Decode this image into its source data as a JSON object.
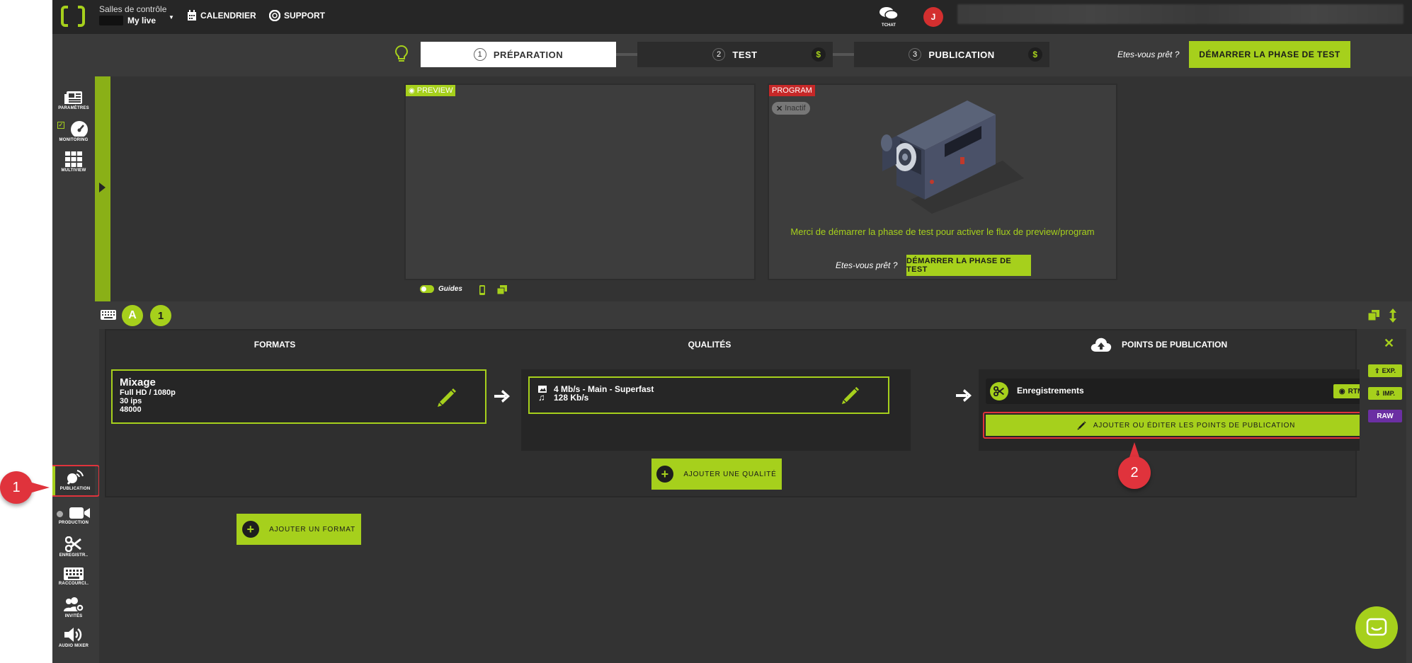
{
  "header": {
    "control_room_label": "Salles de contrôle",
    "live_name": "My live",
    "calendar_label": "CALENDRIER",
    "support_label": "SUPPORT",
    "chat_label": "TCHAT",
    "avatar_initial": "J"
  },
  "steps": [
    {
      "num": "1",
      "label": "PRÉPARATION"
    },
    {
      "num": "2",
      "label": "TEST",
      "badge": "$"
    },
    {
      "num": "3",
      "label": "PUBLICATION",
      "badge": "$"
    }
  ],
  "ready_prompt": "Etes-vous prêt ?",
  "start_test_label": "DÉMARRER LA PHASE DE TEST",
  "sidebar": {
    "top": [
      {
        "label": "PARAMÈTRES",
        "icon": "newspaper-icon"
      },
      {
        "label": "MONITORING",
        "icon": "gauge-icon"
      },
      {
        "label": "MULTIVIEW",
        "icon": "grid-icon"
      }
    ],
    "bottom": [
      {
        "label": "PUBLICATION",
        "icon": "broadcast-icon"
      },
      {
        "label": "PRODUCTION",
        "icon": "video-camera-icon"
      },
      {
        "label": "ENREGISTR..",
        "icon": "scissors-icon"
      },
      {
        "label": "RACCOURCI..",
        "icon": "keyboard-icon"
      },
      {
        "label": "INVITÉS",
        "icon": "users-gear-icon"
      },
      {
        "label": "AUDIO MIXER",
        "icon": "speaker-icon"
      }
    ]
  },
  "preview": {
    "label": "PREVIEW",
    "guides_label": "Guides"
  },
  "program": {
    "label": "PROGRAM",
    "status_badge": "Inactif",
    "message": "Merci de démarrer la phase de test pour activer le flux de preview/program",
    "ready_prompt": "Etes-vous prêt ?",
    "start_label": "DÉMARRER LA PHASE DE TEST"
  },
  "toolbar": {
    "letter_a": "A",
    "number_1": "1"
  },
  "columns": {
    "formats": "FORMATS",
    "qualities": "QUALITÉS",
    "publish_points": "POINTS DE PUBLICATION"
  },
  "format_card": {
    "title": "Mixage",
    "resolution": "Full HD / 1080p",
    "fps": "30 ips",
    "sample_rate": "48000"
  },
  "quality_card": {
    "video": "4 Mb/s  -  Main  -  Superfast",
    "audio": "128 Kb/s"
  },
  "publish_card": {
    "name": "Enregistrements",
    "protocol": "RTMP"
  },
  "add_edit_points_label": "AJOUTER OU ÉDITER LES POINTS DE PUBLICATION",
  "add_quality_label": "AJOUTER UNE QUALITÉ",
  "add_format_label": "AJOUTER UN FORMAT",
  "right_rail": {
    "export_label": "EXP.",
    "import_label": "IMP.",
    "raw_label": "RAW"
  },
  "annotations": {
    "marker_1": "1",
    "marker_2": "2"
  },
  "colors": {
    "accent": "#a6d01c",
    "bg_dark": "#262626",
    "bg_mid": "#3a3a3a",
    "alert_red": "#e0333c",
    "raw_purple": "#6b2fa3"
  }
}
